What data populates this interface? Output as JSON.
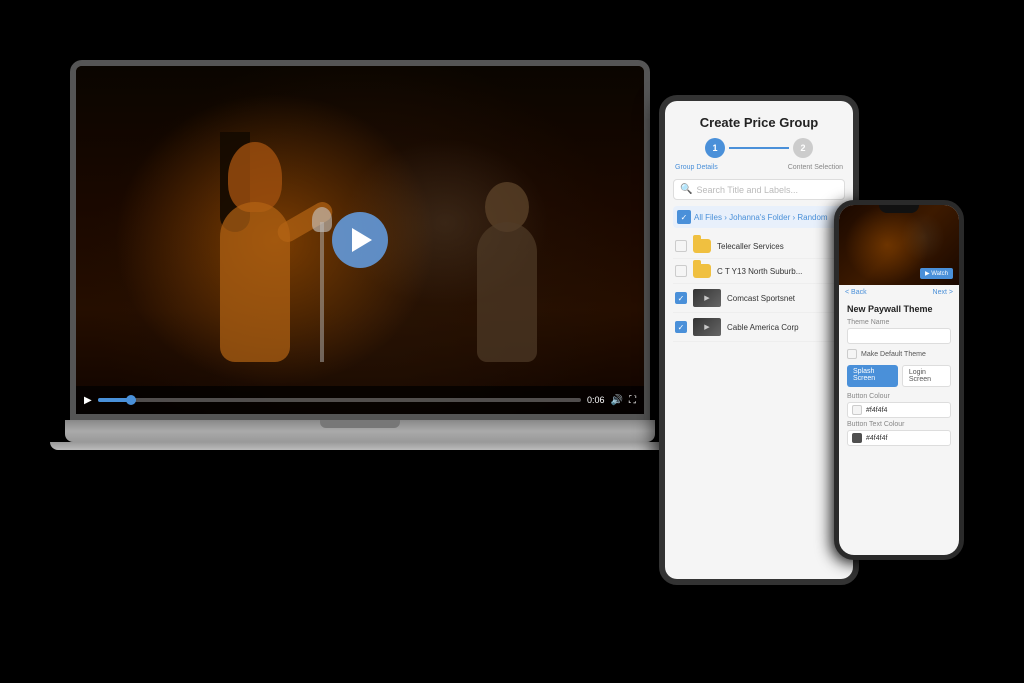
{
  "scene": {
    "background": "#000000"
  },
  "laptop": {
    "video": {
      "alt": "Concert performance with female singer and guitarist"
    },
    "controls": {
      "time": "0:06",
      "progress_percent": 8
    }
  },
  "tablet": {
    "title": "Create Price Group",
    "stepper": {
      "step1_label": "Group Details",
      "step2_label": "Content Selection",
      "step1_num": "1",
      "step2_num": "2"
    },
    "search_placeholder": "Search Title and Labels...",
    "breadcrumb": "All Files › Johanna's Folder › Random",
    "items": [
      {
        "label": "Telecaller Services",
        "type": "folder",
        "checked": false
      },
      {
        "label": "C T Y13 North Suburb...",
        "type": "folder",
        "checked": false
      },
      {
        "label": "Comcast Sportsnet",
        "type": "video",
        "checked": true
      },
      {
        "label": "Cable America Corp",
        "type": "video",
        "checked": true
      }
    ]
  },
  "phone": {
    "back_label": "< Back",
    "header_title": "",
    "action_label": "Next >",
    "section_title": "New Paywall Theme",
    "fields": [
      {
        "label": "Theme Name",
        "type": "input",
        "value": ""
      },
      {
        "label": "Make Default Theme",
        "type": "checkbox"
      }
    ],
    "toggle": {
      "option1": "Splash Screen",
      "option2": "Login Screen"
    },
    "button_color_label": "Button Colour",
    "button_color_value": "#f4f4f4",
    "button_text_color_label": "Button Text Colour",
    "button_text_color_value": "#4f4f4f"
  }
}
